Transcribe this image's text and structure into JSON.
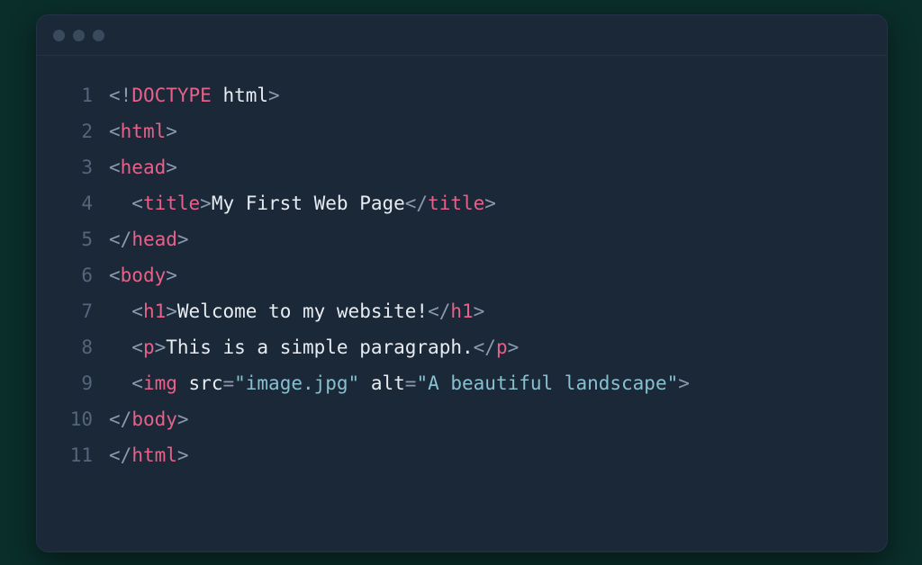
{
  "code": {
    "lines": [
      {
        "num": "1",
        "indent": "",
        "parts": [
          {
            "t": "<",
            "c": "punc"
          },
          {
            "t": "!",
            "c": "punc"
          },
          {
            "t": "DOCTYPE",
            "c": "tag"
          },
          {
            "t": " html",
            "c": "text"
          },
          {
            "t": ">",
            "c": "punc"
          }
        ]
      },
      {
        "num": "2",
        "indent": "",
        "parts": [
          {
            "t": "<",
            "c": "punc"
          },
          {
            "t": "html",
            "c": "tag"
          },
          {
            "t": ">",
            "c": "punc"
          }
        ]
      },
      {
        "num": "3",
        "indent": "",
        "parts": [
          {
            "t": "<",
            "c": "punc"
          },
          {
            "t": "head",
            "c": "tag"
          },
          {
            "t": ">",
            "c": "punc"
          }
        ]
      },
      {
        "num": "4",
        "indent": "  ",
        "parts": [
          {
            "t": "<",
            "c": "punc"
          },
          {
            "t": "title",
            "c": "tag"
          },
          {
            "t": ">",
            "c": "punc"
          },
          {
            "t": "My First Web Page",
            "c": "text"
          },
          {
            "t": "<",
            "c": "punc"
          },
          {
            "t": "/",
            "c": "punc"
          },
          {
            "t": "title",
            "c": "tag"
          },
          {
            "t": ">",
            "c": "punc"
          }
        ]
      },
      {
        "num": "5",
        "indent": "",
        "parts": [
          {
            "t": "<",
            "c": "punc"
          },
          {
            "t": "/",
            "c": "punc"
          },
          {
            "t": "head",
            "c": "tag"
          },
          {
            "t": ">",
            "c": "punc"
          }
        ]
      },
      {
        "num": "6",
        "indent": "",
        "parts": [
          {
            "t": "<",
            "c": "punc"
          },
          {
            "t": "body",
            "c": "tag"
          },
          {
            "t": ">",
            "c": "punc"
          }
        ]
      },
      {
        "num": "7",
        "indent": "  ",
        "parts": [
          {
            "t": "<",
            "c": "punc"
          },
          {
            "t": "h1",
            "c": "tag"
          },
          {
            "t": ">",
            "c": "punc"
          },
          {
            "t": "Welcome to my website!",
            "c": "text"
          },
          {
            "t": "<",
            "c": "punc"
          },
          {
            "t": "/",
            "c": "punc"
          },
          {
            "t": "h1",
            "c": "tag"
          },
          {
            "t": ">",
            "c": "punc"
          }
        ]
      },
      {
        "num": "8",
        "indent": "  ",
        "parts": [
          {
            "t": "<",
            "c": "punc"
          },
          {
            "t": "p",
            "c": "tag"
          },
          {
            "t": ">",
            "c": "punc"
          },
          {
            "t": "This is a simple paragraph.",
            "c": "text"
          },
          {
            "t": "<",
            "c": "punc"
          },
          {
            "t": "/",
            "c": "punc"
          },
          {
            "t": "p",
            "c": "tag"
          },
          {
            "t": ">",
            "c": "punc"
          }
        ]
      },
      {
        "num": "9",
        "indent": "  ",
        "parts": [
          {
            "t": "<",
            "c": "punc"
          },
          {
            "t": "img",
            "c": "tag"
          },
          {
            "t": " src",
            "c": "attr"
          },
          {
            "t": "=",
            "c": "punc"
          },
          {
            "t": "\"image.jpg\"",
            "c": "str"
          },
          {
            "t": " alt",
            "c": "attr"
          },
          {
            "t": "=",
            "c": "punc"
          },
          {
            "t": "\"A beautiful landscape\"",
            "c": "str"
          },
          {
            "t": ">",
            "c": "punc"
          }
        ]
      },
      {
        "num": "10",
        "indent": "",
        "parts": [
          {
            "t": "<",
            "c": "punc"
          },
          {
            "t": "/",
            "c": "punc"
          },
          {
            "t": "body",
            "c": "tag"
          },
          {
            "t": ">",
            "c": "punc"
          }
        ]
      },
      {
        "num": "11",
        "indent": "",
        "parts": [
          {
            "t": "<",
            "c": "punc"
          },
          {
            "t": "/",
            "c": "punc"
          },
          {
            "t": "html",
            "c": "tag"
          },
          {
            "t": ">",
            "c": "punc"
          }
        ]
      }
    ]
  }
}
